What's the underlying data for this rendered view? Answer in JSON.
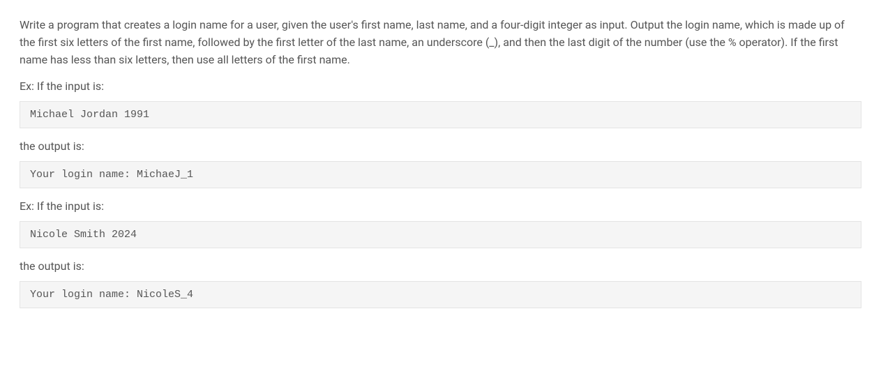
{
  "problem": {
    "description": "Write a program that creates a login name for a user, given the user's first name, last name, and a four-digit integer as input. Output the login name, which is made up of the first six letters of the first name, followed by the first letter of the last name, an underscore (_), and then the last digit of the number (use the % operator). If the first name has less than six letters, then use all letters of the first name."
  },
  "examples": [
    {
      "input_label": "Ex: If the input is:",
      "input_code": "Michael Jordan 1991",
      "output_label": "the output is:",
      "output_code": "Your login name: MichaeJ_1"
    },
    {
      "input_label": "Ex: If the input is:",
      "input_code": "Nicole Smith 2024",
      "output_label": "the output is:",
      "output_code": "Your login name: NicoleS_4"
    }
  ]
}
